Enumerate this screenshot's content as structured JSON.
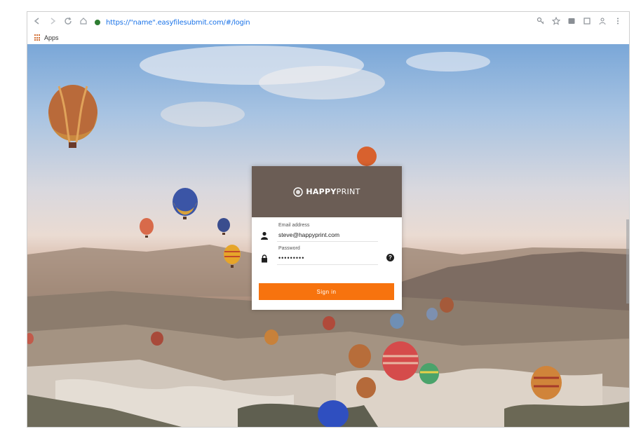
{
  "browser": {
    "url": "https://\"name\".easyfilesubmit.com/#/login",
    "bookmarks": [
      {
        "label": "Apps"
      }
    ]
  },
  "login": {
    "brand_bold": "HAPPY",
    "brand_regular": "PRINT",
    "email_label": "Email address",
    "email_value": "steve@happyprint.com",
    "password_label": "Password",
    "password_value": "•••••••••",
    "help_glyph": "?",
    "signin_label": "Sign in"
  },
  "colors": {
    "header_bg": "#6b5d55",
    "button_bg": "#f7730e"
  }
}
